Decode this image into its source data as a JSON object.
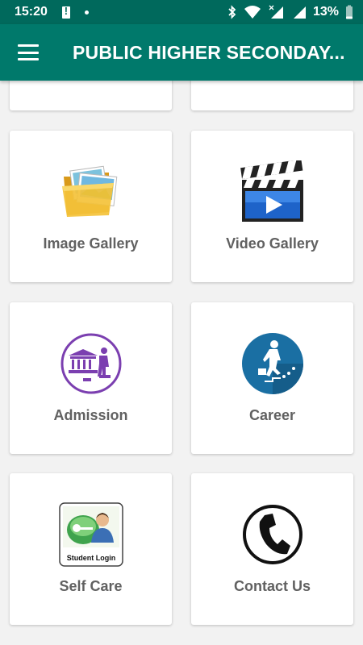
{
  "status_bar": {
    "time": "15:20",
    "battery_percent": "13%"
  },
  "app_bar": {
    "title": "PUBLIC HIGHER SECONDAY..."
  },
  "grid": {
    "items": [
      {
        "label": "Image Gallery",
        "icon": "image-gallery-icon"
      },
      {
        "label": "Video Gallery",
        "icon": "video-gallery-icon"
      },
      {
        "label": "Admission",
        "icon": "admission-icon"
      },
      {
        "label": "Career",
        "icon": "career-icon"
      },
      {
        "label": "Self Care",
        "icon": "student-login-icon",
        "icon_text": "Student Login"
      },
      {
        "label": "Contact Us",
        "icon": "phone-icon"
      }
    ]
  },
  "colors": {
    "status_bar": "#00695c",
    "app_bar": "#00796b",
    "label": "#616161",
    "admission_accent": "#7b3fb0",
    "career_accent": "#1a6fa3"
  }
}
